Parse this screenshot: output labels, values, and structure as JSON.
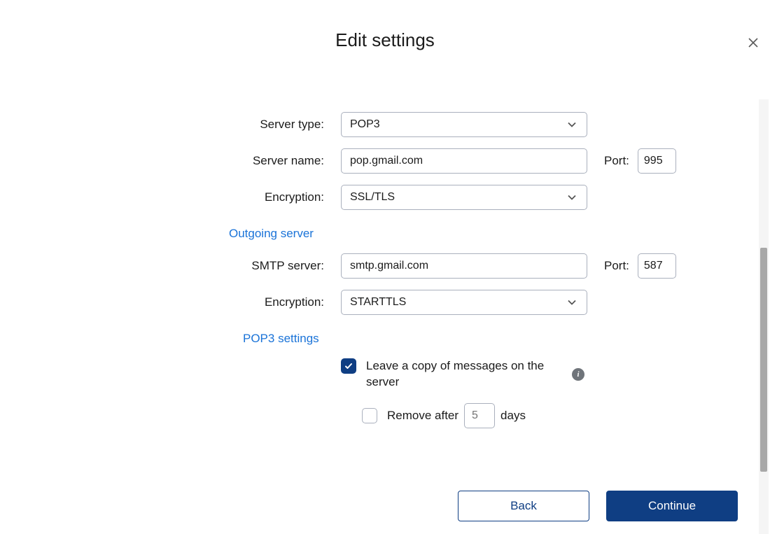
{
  "title": "Edit settings",
  "incoming": {
    "server_type_label": "Server type:",
    "server_type_value": "POP3",
    "server_name_label": "Server name:",
    "server_name_value": "pop.gmail.com",
    "port_label": "Port:",
    "port_value": "995",
    "encryption_label": "Encryption:",
    "encryption_value": "SSL/TLS"
  },
  "outgoing": {
    "header": "Outgoing server",
    "smtp_label": "SMTP server:",
    "smtp_value": "smtp.gmail.com",
    "port_label": "Port:",
    "port_value": "587",
    "encryption_label": "Encryption:",
    "encryption_value": "STARTTLS"
  },
  "pop3": {
    "header": "POP3 settings",
    "leave_copy_label": "Leave a copy of messages on the server",
    "leave_copy_checked": true,
    "remove_after_label_before": "Remove after",
    "remove_after_label_after": "days",
    "remove_after_days_placeholder": "5",
    "remove_after_checked": false
  },
  "footer": {
    "back": "Back",
    "continue": "Continue"
  }
}
